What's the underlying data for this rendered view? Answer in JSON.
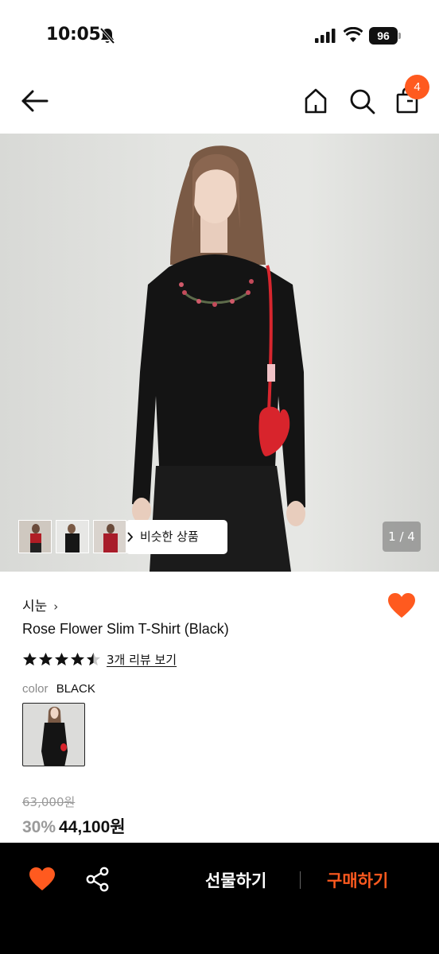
{
  "status_bar": {
    "time": "10:05",
    "battery": "96",
    "icons": [
      "bell-slash-icon",
      "signal-icon",
      "wifi-icon",
      "battery-icon"
    ]
  },
  "header": {
    "icons": [
      "back-arrow-icon",
      "home-icon",
      "search-icon",
      "shopping-bag-icon"
    ],
    "cart_count": "4"
  },
  "gallery": {
    "similar_label": "비슷한 상품",
    "counter": "1 / 4"
  },
  "product": {
    "brand": "시눈",
    "name": "Rose Flower Slim T-Shirt (Black)",
    "rating": 4.5,
    "review_link": "3개 리뷰 보기",
    "color_label": "color",
    "color_value": "BLACK",
    "original_price": "63,000원",
    "discount": "30%",
    "sale_price": "44,100원"
  },
  "bottom_bar": {
    "gift_label": "선물하기",
    "buy_label": "구매하기"
  },
  "colors": {
    "accent": "#ff5a1f",
    "text": "#111111",
    "muted": "#9a9a9a",
    "bottom_bar": "#000000"
  }
}
